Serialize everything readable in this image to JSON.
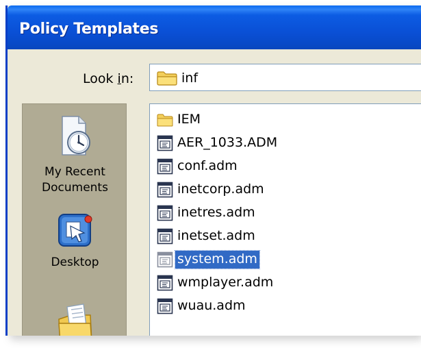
{
  "window": {
    "title": "Policy Templates"
  },
  "lookin": {
    "label_pre": "Look ",
    "label_accel": "i",
    "label_post": "n:",
    "value": "inf",
    "icon": "folder-icon"
  },
  "places": [
    {
      "label": "My Recent\nDocuments",
      "icon": "recent-documents-icon"
    },
    {
      "label": "Desktop",
      "icon": "desktop-icon"
    },
    {
      "label": "",
      "icon": "my-documents-icon"
    }
  ],
  "files": [
    {
      "name": "IEM",
      "icon": "folder-icon",
      "selected": false
    },
    {
      "name": "AER_1033.ADM",
      "icon": "adm-file-icon",
      "selected": false
    },
    {
      "name": "conf.adm",
      "icon": "adm-file-icon",
      "selected": false
    },
    {
      "name": "inetcorp.adm",
      "icon": "adm-file-icon",
      "selected": false
    },
    {
      "name": "inetres.adm",
      "icon": "adm-file-icon",
      "selected": false
    },
    {
      "name": "inetset.adm",
      "icon": "adm-file-icon",
      "selected": false
    },
    {
      "name": "system.adm",
      "icon": "adm-file-icon",
      "selected": true
    },
    {
      "name": "wmplayer.adm",
      "icon": "adm-file-icon",
      "selected": false
    },
    {
      "name": "wuau.adm",
      "icon": "adm-file-icon",
      "selected": false
    }
  ],
  "colors": {
    "titlebar": "#0a50d6",
    "dialog_bg": "#ece9d8",
    "places_bg": "#b0ab94",
    "selection": "#316ac5"
  }
}
